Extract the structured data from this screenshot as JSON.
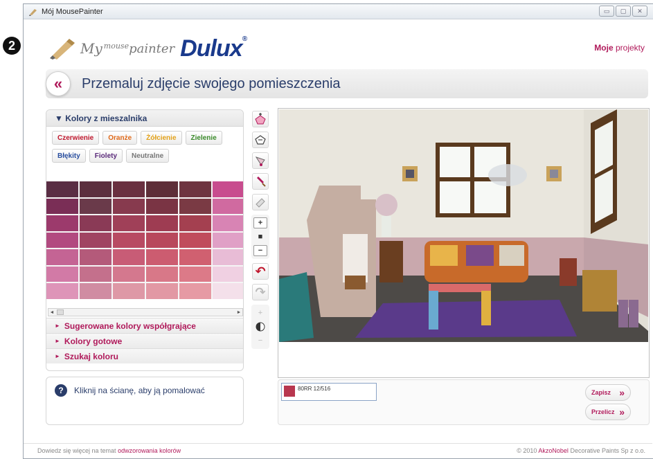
{
  "window": {
    "title": "Mój MousePainter",
    "controls": [
      "▭",
      "▢",
      "✕"
    ]
  },
  "step_badge": "2",
  "header": {
    "logo_my": "My",
    "logo_mouse": "mouse",
    "logo_painter": "painter",
    "logo_brand": "Dulux",
    "logo_reg": "®",
    "projects_bold": "Moje",
    "projects_rest": " projekty"
  },
  "page": {
    "back_label": "«",
    "title": "Przemaluj zdjęcie swojego pomieszczenia"
  },
  "left_panel": {
    "mixer_header": "▼ Kolory z mieszalnika",
    "chips": [
      {
        "label": "Czerwienie",
        "color": "#c0182e"
      },
      {
        "label": "Oranże",
        "color": "#e06a1a"
      },
      {
        "label": "Żółcienie",
        "color": "#e3a21a"
      },
      {
        "label": "Zielenie",
        "color": "#3a8a2a"
      },
      {
        "label": "Błękity",
        "color": "#2a4fa0"
      },
      {
        "label": "Fiolety",
        "color": "#5a2a7a"
      },
      {
        "label": "Neutralne",
        "color": "#777777"
      }
    ],
    "swatch_colors": [
      "#5a2e44",
      "#5c2f3e",
      "#6a3040",
      "#5e2e38",
      "#6e3440",
      "#c84c8e",
      "#7a2e56",
      "#6a3a4a",
      "#873a4e",
      "#7a3444",
      "#7a3a44",
      "#d06aa0",
      "#9c3a6c",
      "#8a3a56",
      "#a04058",
      "#9e3c52",
      "#a44050",
      "#d884b4",
      "#b24a80",
      "#a04462",
      "#b84a62",
      "#b8485c",
      "#c04c5c",
      "#e0a0c6",
      "#c46494",
      "#b45a7a",
      "#c85c76",
      "#cc5c70",
      "#d06070",
      "#e8bcd6",
      "#d27aa6",
      "#c4708c",
      "#d4788e",
      "#d87888",
      "#dc7a88",
      "#f0d0e2",
      "#de94b8",
      "#d08ca2",
      "#de98a6",
      "#e298a4",
      "#e69aa4",
      "#f4e0ea"
    ],
    "accordion": [
      "Sugerowane kolory współgrające",
      "Kolory gotowe",
      "Szukaj koloru"
    ]
  },
  "help": {
    "icon": "?",
    "text": "Kliknij na ścianę, aby ją pomalować"
  },
  "tools": {
    "zoom_in": "+",
    "zoom_reset": "■",
    "zoom_out": "−",
    "undo": "↶",
    "redo": "↷",
    "brightness_plus": "+",
    "brightness_minus": "−"
  },
  "bottom": {
    "selected_color_code": "80RR 12/516",
    "selected_color": "#b8374f",
    "save_label": "Zapisz",
    "recalc_label": "Przelicz",
    "chevron": "»"
  },
  "footer": {
    "left_text": "Dowiedz się więcej na temat ",
    "left_link": "odwzorowania kolorów",
    "right_text": "© 2010 ",
    "right_link": "AkzoNobel",
    "right_rest": " Decorative Paints Sp z o.o."
  }
}
